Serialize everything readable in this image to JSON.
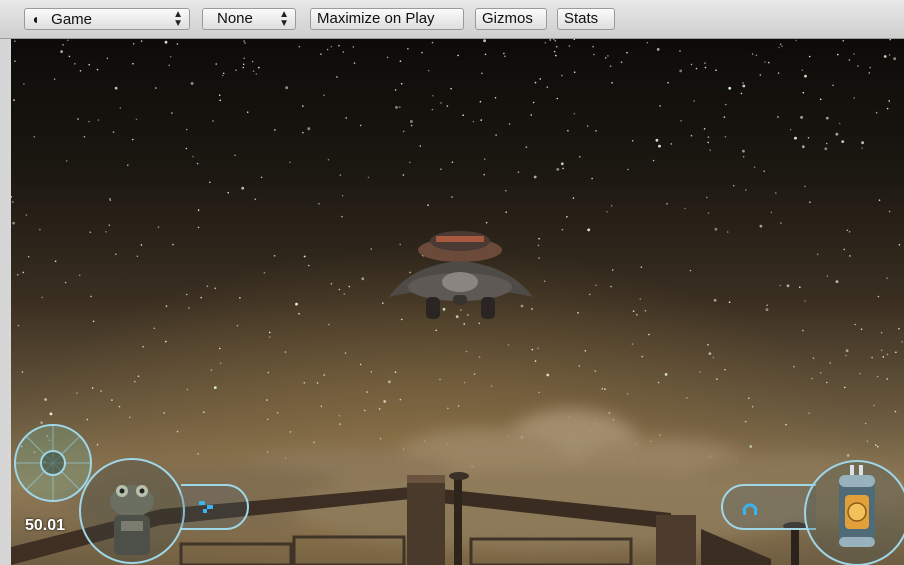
{
  "toolbar": {
    "view_select_label": "Game",
    "aspect_select_label": "None",
    "maximize_label": "Maximize on Play",
    "gizmos_label": "Gizmos",
    "stats_label": "Stats"
  },
  "hud": {
    "fps_readout": "50.01"
  },
  "colors": {
    "hud_ring": "#9fd6e8",
    "hud_accent": "#39b4f0"
  }
}
